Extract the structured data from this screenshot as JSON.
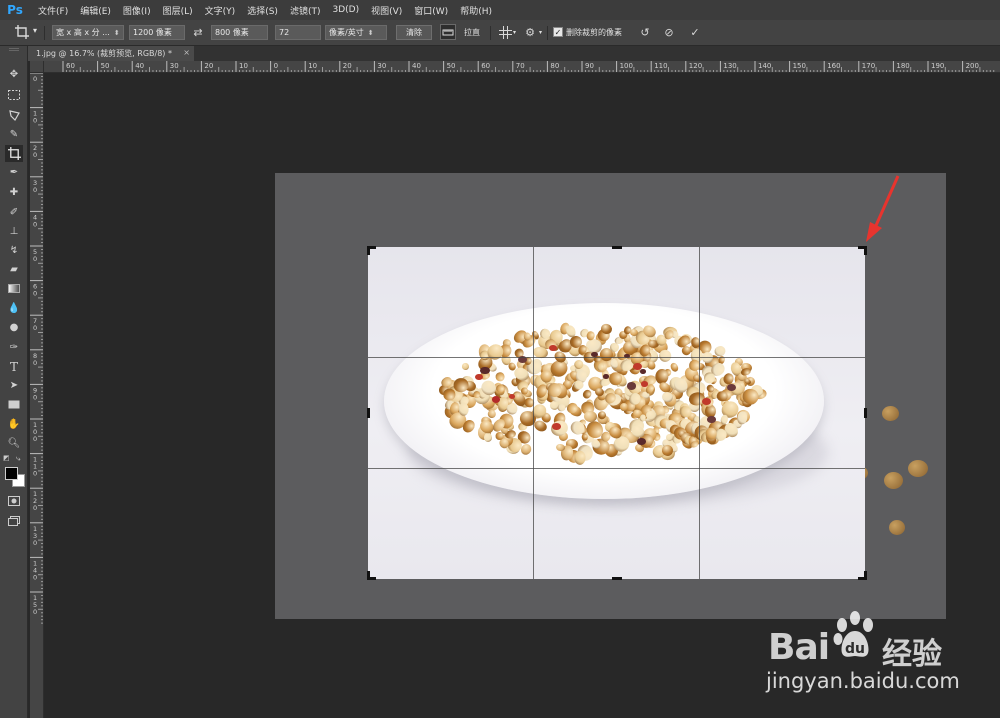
{
  "app": {
    "logo": "Ps"
  },
  "menu": [
    "文件(F)",
    "编辑(E)",
    "图像(I)",
    "图层(L)",
    "文字(Y)",
    "选择(S)",
    "滤镜(T)",
    "3D(D)",
    "视图(V)",
    "窗口(W)",
    "帮助(H)"
  ],
  "options": {
    "ratio_select": "宽 x 高 x 分 ...",
    "width_value": "1200 像素",
    "height_value": "800 像素",
    "resolution_value": "72",
    "resolution_unit": "像素/英寸",
    "clear_button": "清除",
    "straighten_label": "拉直",
    "delete_cropped_label": "删除裁剪的像素",
    "delete_cropped_checked": true
  },
  "tab": {
    "title": "1.jpg @ 16.7% (裁剪预览, RGB/8) *",
    "close": "×"
  },
  "ruler": {
    "top_labels": [
      "60",
      "50",
      "40",
      "30",
      "20",
      "10",
      "0",
      "10",
      "20",
      "30",
      "40",
      "50",
      "60",
      "70",
      "80",
      "90",
      "100",
      "110",
      "120",
      "130",
      "140",
      "150",
      "160",
      "170",
      "180",
      "190",
      "200"
    ],
    "left_labels": [
      "0",
      "1 0",
      "2 0",
      "3 0",
      "4 0",
      "5 0",
      "6 0",
      "7 0",
      "8 0",
      "9 0",
      "1 0 0",
      "1 1 0",
      "1 2 0",
      "1 3 0",
      "1 4 0",
      "1 5 0"
    ]
  },
  "toolbar": [
    "move-tool",
    "marquee-tool",
    "lasso-tool",
    "quick-select-tool",
    "crop-tool",
    "eyedropper-tool",
    "healing-brush-tool",
    "brush-tool",
    "clone-stamp-tool",
    "history-brush-tool",
    "eraser-tool",
    "gradient-tool",
    "blur-tool",
    "dodge-tool",
    "pen-tool",
    "type-tool",
    "path-select-tool",
    "rectangle-tool",
    "hand-tool",
    "zoom-tool"
  ],
  "colors": {
    "foreground": "#000000",
    "background": "#ffffff",
    "annotation_arrow": "#e8342e"
  },
  "watermark": {
    "brand": "Bai",
    "brand_cn": "经验",
    "url": "jingyan.baidu.com"
  }
}
